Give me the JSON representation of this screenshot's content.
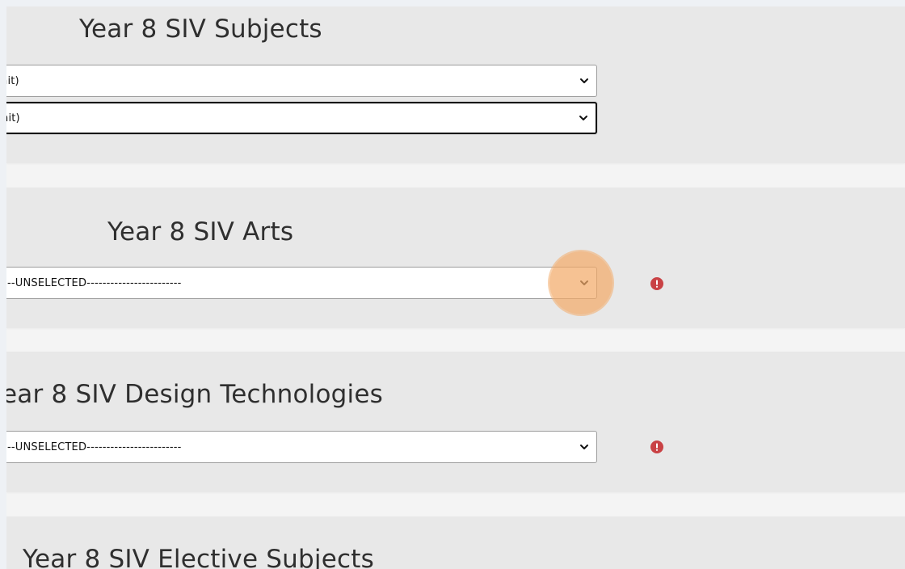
{
  "colors": {
    "page_bg": "#eef1f5",
    "panel_bg": "#e8e8e8",
    "border": "#9c9c9c",
    "error_red": "#c94245",
    "highlight_orange": "#f3ab69"
  },
  "panels": [
    {
      "title": "Year 8 SIV Subjects",
      "selects": [
        {
          "value": "nit)"
        },
        {
          "value": "nit)"
        }
      ]
    },
    {
      "title": "Year 8 SIV Arts",
      "selects": [
        {
          "value": "--UNSELECTED------------------------"
        }
      ]
    },
    {
      "title": "ear 8 SIV Design Technologies",
      "selects": [
        {
          "value": "--UNSELECTED------------------------"
        }
      ]
    },
    {
      "title": "Year 8 SIV Elective Subjects"
    }
  ],
  "icons": {
    "dropdown": "chevron-down-icon",
    "error": "error-icon"
  }
}
